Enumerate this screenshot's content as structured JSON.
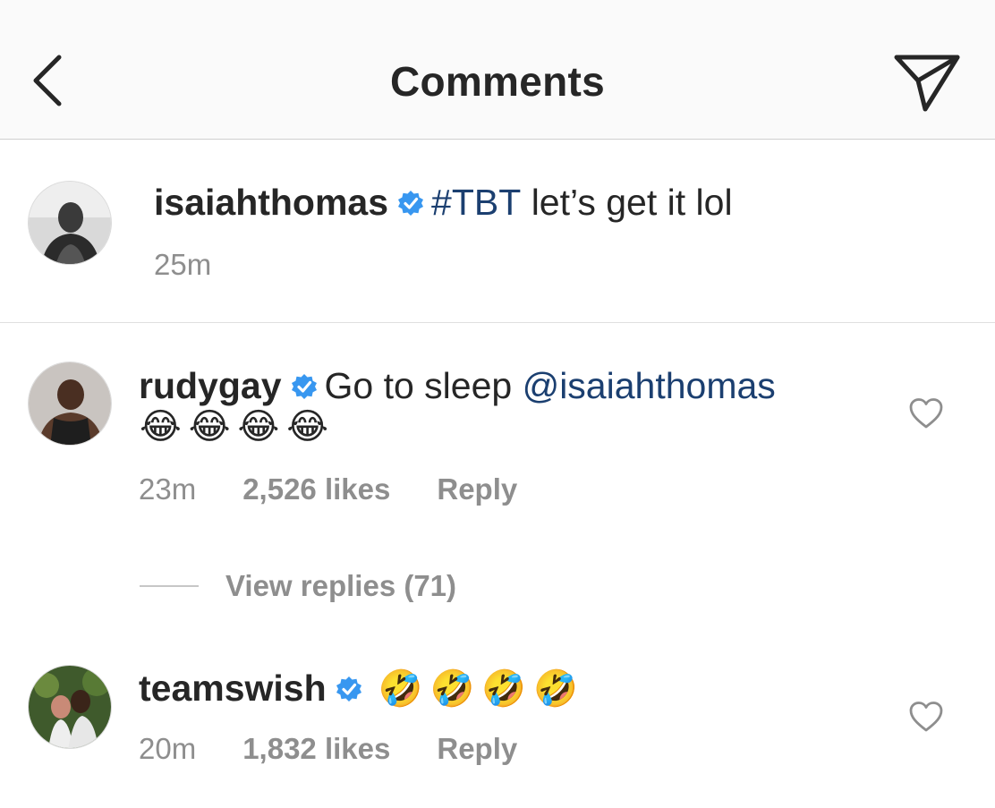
{
  "header": {
    "title": "Comments",
    "back_icon": "chevron-left-icon",
    "share_icon": "send-paper-plane-icon"
  },
  "colors": {
    "link": "#1b3f70",
    "verified": "#3897f0",
    "muted": "#8e8e8e",
    "text": "#262626"
  },
  "caption": {
    "username": "isaiahthomas",
    "verified": true,
    "hashtag": "#TBT",
    "text": " let’s get it lol",
    "time": "25m"
  },
  "comments": [
    {
      "username": "rudygay",
      "verified": true,
      "text": "Go to sleep ",
      "mention": "@isaiahthomas",
      "emojis": "😂😂😂😂",
      "time": "23m",
      "likes": "2,526 likes",
      "reply_label": "Reply",
      "view_replies": "View replies (71)"
    },
    {
      "username": "teamswish",
      "verified": true,
      "emojis": "🤣🤣🤣🤣",
      "time": "20m",
      "likes": "1,832 likes",
      "reply_label": "Reply"
    }
  ]
}
